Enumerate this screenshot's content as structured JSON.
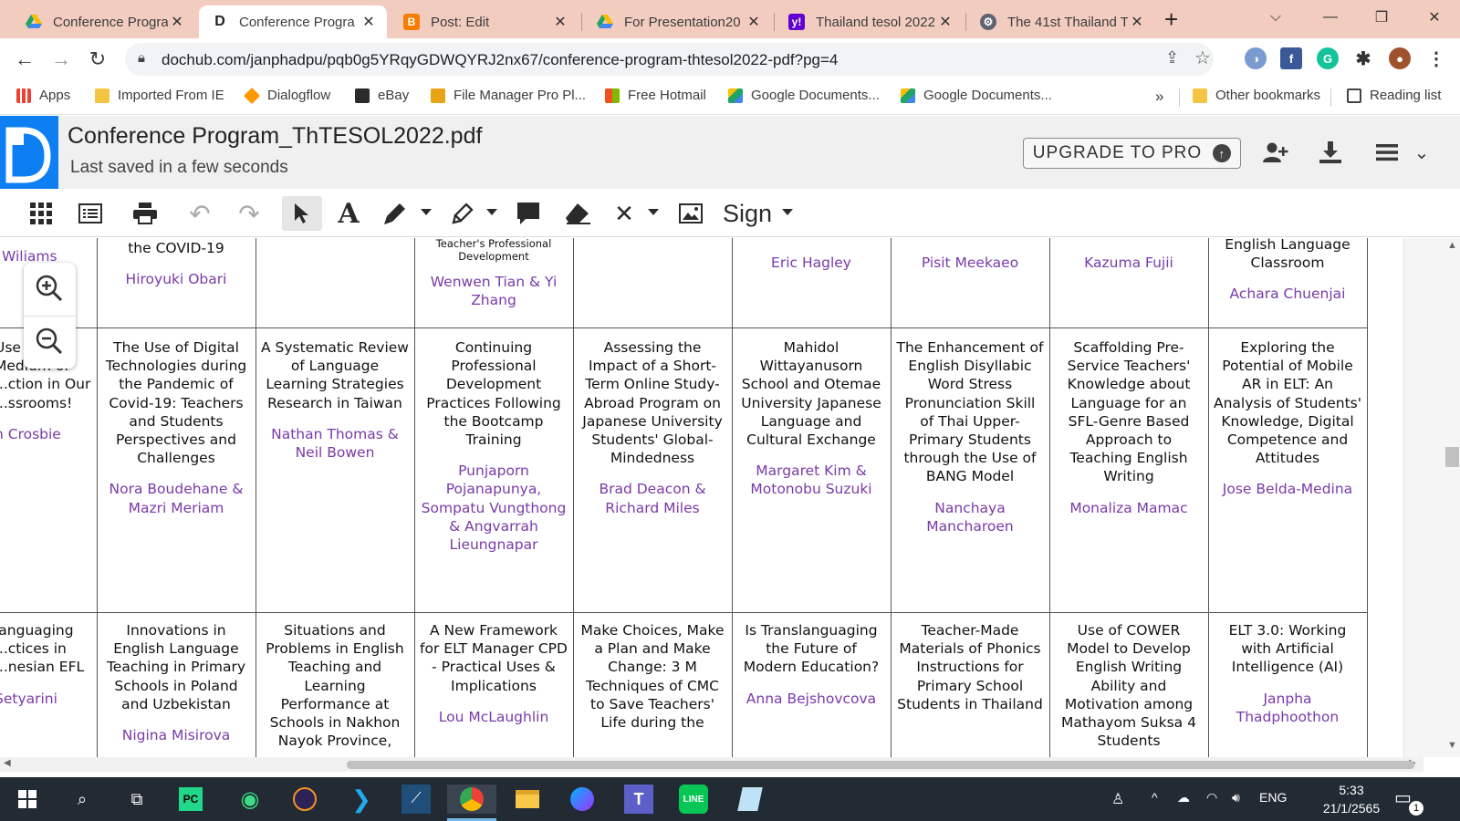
{
  "browser": {
    "tabs": [
      {
        "title": "Conference Progra",
        "icon": "google-drive-icon",
        "active": false
      },
      {
        "title": "Conference Progra",
        "icon": "dochub-icon",
        "active": true
      },
      {
        "title": "Post: Edit",
        "icon": "blogger-icon",
        "active": false
      },
      {
        "title": "For Presentation20",
        "icon": "google-drive-icon",
        "active": false
      },
      {
        "title": "Thailand tesol 2022",
        "icon": "yahoo-icon",
        "active": false
      },
      {
        "title": "The 41st Thailand T",
        "icon": "web-icon",
        "active": false
      }
    ],
    "new_tab": "+",
    "close": "✕",
    "url": "dochub.com/janphadpu/pqb0g5YRqyGDWQYRJ2nx67/conference-program-thtesol2022-pdf?pg=4",
    "bookmarks": [
      {
        "label": "Apps",
        "icon": "apps-grid-icon"
      },
      {
        "label": "Imported From IE",
        "icon": "folder-icon"
      },
      {
        "label": "Dialogflow",
        "icon": "dialogflow-icon"
      },
      {
        "label": "eBay",
        "icon": "ebay-icon"
      },
      {
        "label": "File Manager Pro Pl...",
        "icon": "file-manager-icon"
      },
      {
        "label": "Free Hotmail",
        "icon": "microsoft-icon"
      },
      {
        "label": "Google Documents...",
        "icon": "google-drive-icon"
      },
      {
        "label": "Google Documents...",
        "icon": "google-drive-icon"
      }
    ],
    "more_bookmarks": "»",
    "other_bookmarks": "Other bookmarks",
    "reading_list": "Reading list"
  },
  "dochub": {
    "title": "Conference Program_ThTESOL2022.pdf",
    "saved_status": "Last saved in a few seconds",
    "upgrade_label": "UPGRADE TO PRO",
    "sign_label": "Sign"
  },
  "document": {
    "row1": [
      {
        "title": "Wiliams",
        "authors": ""
      },
      {
        "title": "the COVID-19",
        "authors": "Hiroyuki Obari"
      },
      {
        "title": "",
        "authors": ""
      },
      {
        "title": "Teacher's Professional Development",
        "authors": "Wenwen Tian & Yi Zhang"
      },
      {
        "title": "",
        "authors": ""
      },
      {
        "title": "",
        "authors": "Eric Hagley"
      },
      {
        "title": "",
        "authors": "Pisit Meekaeo"
      },
      {
        "title": "",
        "authors": "Kazuma Fujii"
      },
      {
        "title": "English Language Classroom",
        "authors": "Achara Chuenjai"
      }
    ],
    "row2": [
      {
        "title": "Use ... Medium of ...ction in Our ...ssrooms!",
        "authors": "n Crosbie"
      },
      {
        "title": "The Use of Digital Technologies during the Pandemic of Covid-19: Teachers and Students Perspectives and Challenges",
        "authors": "Nora Boudehane & Mazri Meriam"
      },
      {
        "title": "A Systematic Review of Language Learning Strategies Research in Taiwan",
        "authors": "Nathan Thomas & Neil Bowen"
      },
      {
        "title": "Continuing Professional Development Practices Following the Bootcamp Training",
        "authors": "Punjaporn Pojanapunya, Sompatu Vungthong & Angvarrah Lieungnapar"
      },
      {
        "title": "Assessing the Impact of a Short-Term Online Study-Abroad Program on Japanese University Students' Global-Mindedness",
        "authors": "Brad Deacon & Richard Miles"
      },
      {
        "title": "Mahidol Wittayanusorn School and Otemae University Japanese Language and Cultural Exchange",
        "authors": "Margaret Kim & Motonobu Suzuki"
      },
      {
        "title": "The Enhancement of English Disyllabic Word Stress Pronunciation Skill of Thai Upper-Primary Students through the Use of BANG Model",
        "authors": "Nanchaya Mancharoen"
      },
      {
        "title": "Scaffolding Pre-Service Teachers' Knowledge about Language for an SFL-Genre Based Approach to Teaching English Writing",
        "authors": "Monaliza Mamac"
      },
      {
        "title": "Exploring the Potential of Mobile AR in ELT: An Analysis of Students' Knowledge, Digital Competence and Attitudes",
        "authors": "Jose Belda-Medina"
      }
    ],
    "row3": [
      {
        "title": "languaging ...ctices in ...nesian EFL",
        "authors": "Setyarini"
      },
      {
        "title": "Innovations in English Language Teaching in Primary Schools in Poland and Uzbekistan",
        "authors": "Nigina Misirova"
      },
      {
        "title": "Situations and Problems in English Teaching and Learning Performance at Schools in Nakhon Nayok Province,",
        "authors": ""
      },
      {
        "title": "A New Framework for ELT Manager CPD - Practical Uses & Implications",
        "authors": "Lou McLaughlin"
      },
      {
        "title": "Make Choices, Make a Plan and Make Change: 3 M Techniques of CMC to Save Teachers' Life during the",
        "authors": ""
      },
      {
        "title": "Is Translanguaging the Future of Modern Education?",
        "authors": "Anna Bejshovcova"
      },
      {
        "title": "Teacher-Made Materials of Phonics Instructions for Primary School Students in Thailand",
        "authors": ""
      },
      {
        "title": "Use of COWER Model to Develop English Writing Ability and Motivation among Mathayom Suksa 4 Students",
        "authors": ""
      },
      {
        "title": "ELT 3.0: Working with Artificial Intelligence (AI)",
        "authors": "Janpha Thadphoothon"
      }
    ]
  },
  "taskbar": {
    "language": "ENG",
    "time": "5:33",
    "date": "21/1/2565",
    "notification_count": "1"
  },
  "colors": {
    "tab_strip": "#f3ccc0",
    "dochub_blue": "#0d7ff2",
    "author_purple": "#7a3aa8",
    "taskbar": "#222a33"
  }
}
